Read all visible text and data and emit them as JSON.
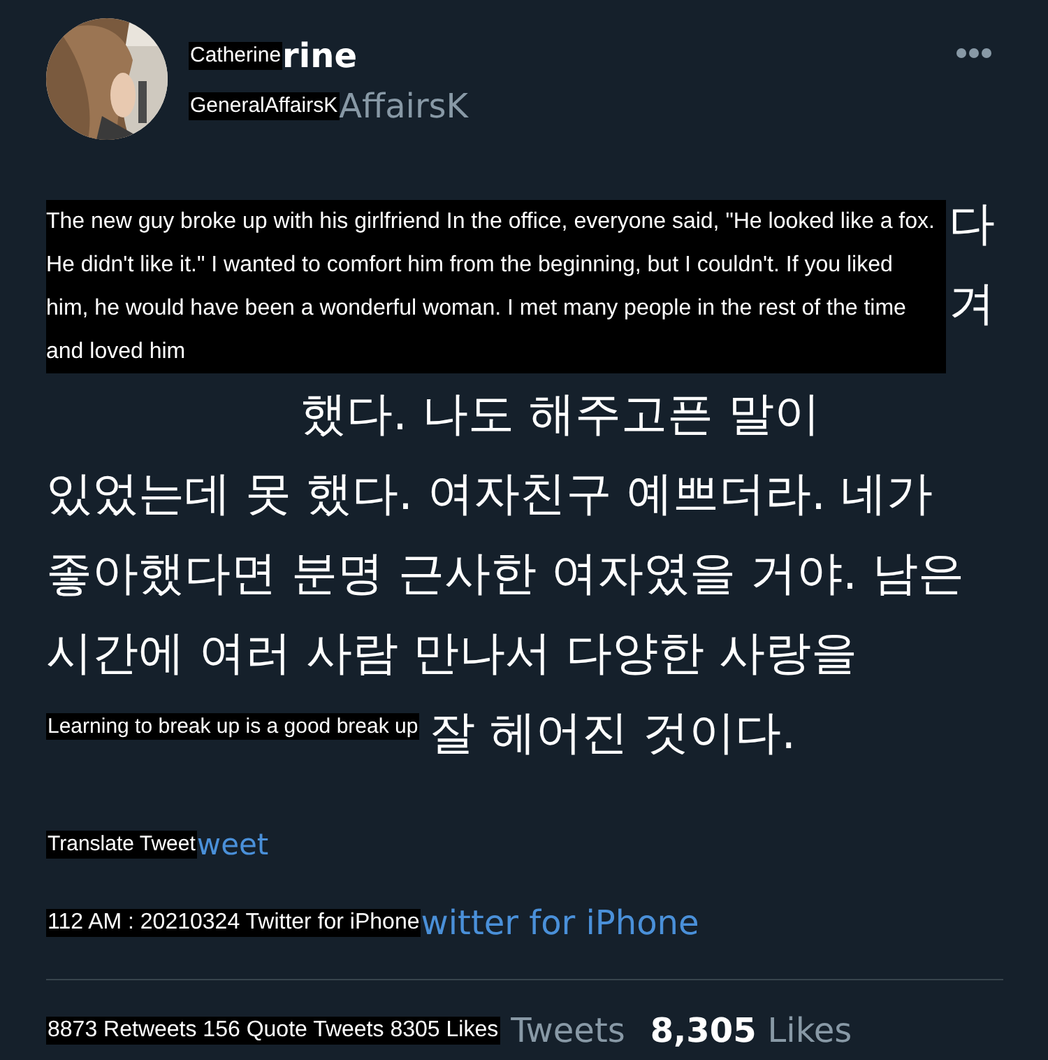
{
  "author": {
    "name": {
      "caption": "Catherine",
      "visible": "rine"
    },
    "handle": {
      "caption": "GeneralAffairsK",
      "visible": "AffairsK"
    }
  },
  "tweet": {
    "caption": "The new guy broke up with his girlfriend In the office, everyone said, \"He looked like a fox. He didn't like it.\" I wanted to comfort him from the beginning, but I couldn't. If you liked him, he would have been a wonderful woman. I met many people in the rest of the time and loved him",
    "closing_caption": "Learning to break up is a good break up",
    "lines": [
      {
        "kind": "tail",
        "text": "다"
      },
      {
        "kind": "tail",
        "text": "겨"
      },
      {
        "kind": "partial",
        "text": "했다. 나도 해주고픈 말이"
      },
      {
        "kind": "full",
        "text": "있었는데 못 했다. 여자친구 예쁘더라. 네가"
      },
      {
        "kind": "full",
        "text": "좋아했다면 분명 근사한 여자였을 거야. 남은"
      },
      {
        "kind": "full",
        "text": "시간에 여러 사람 만나서 다양한 사랑을"
      },
      {
        "kind": "captioned",
        "text": "잘 헤어진 것이다."
      }
    ]
  },
  "translate": {
    "caption": "Translate Tweet",
    "visible": "weet"
  },
  "timestamp": {
    "caption": "112 AM : 20210324 Twitter for iPhone",
    "visible": "witter for iPhone"
  },
  "stats": {
    "caption": "8873 Retweets 156 Quote Tweets 8305 Likes",
    "items": [
      {
        "kind": "label",
        "text": "Tweets"
      },
      {
        "kind": "count",
        "text": "8,305"
      },
      {
        "kind": "label",
        "text": "Likes"
      }
    ]
  }
}
